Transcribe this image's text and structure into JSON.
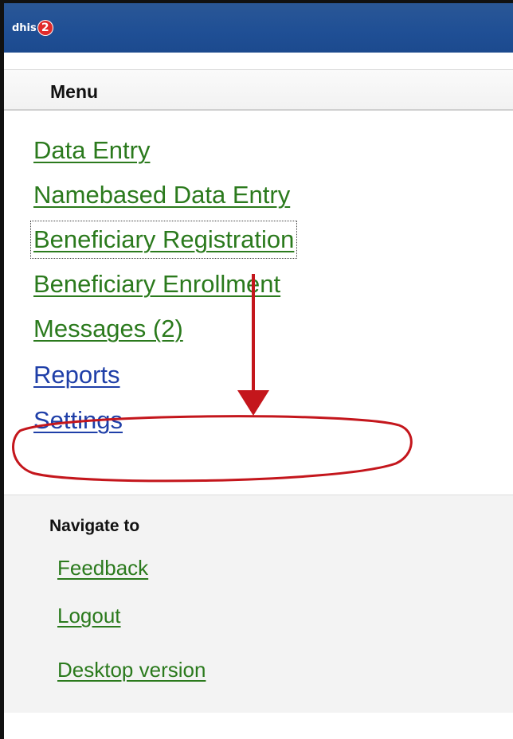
{
  "header": {
    "logo_text": "dhis",
    "logo_badge": "2"
  },
  "menu": {
    "title": "Menu",
    "items": [
      {
        "label": "Data Entry",
        "color": "#2b7a1d"
      },
      {
        "label": "Namebased Data Entry",
        "color": "#2b7a1d"
      },
      {
        "label": "Beneficiary Registration",
        "color": "#2b7a1d",
        "focused": true
      },
      {
        "label": "Beneficiary Enrollment",
        "color": "#2b7a1d"
      },
      {
        "label": "Messages (2)",
        "color": "#2b7a1d"
      },
      {
        "label": "Reports",
        "color": "#1f3fa8"
      },
      {
        "label": "Settings",
        "color": "#1f3fa8",
        "highlighted": true
      }
    ]
  },
  "navigate": {
    "title": "Navigate to",
    "items": [
      {
        "label": "Feedback"
      },
      {
        "label": "Logout"
      },
      {
        "label": "Desktop version"
      }
    ]
  },
  "annotation": {
    "arrow_color": "#c4161c",
    "circle_color": "#c4161c",
    "target": "Settings"
  }
}
